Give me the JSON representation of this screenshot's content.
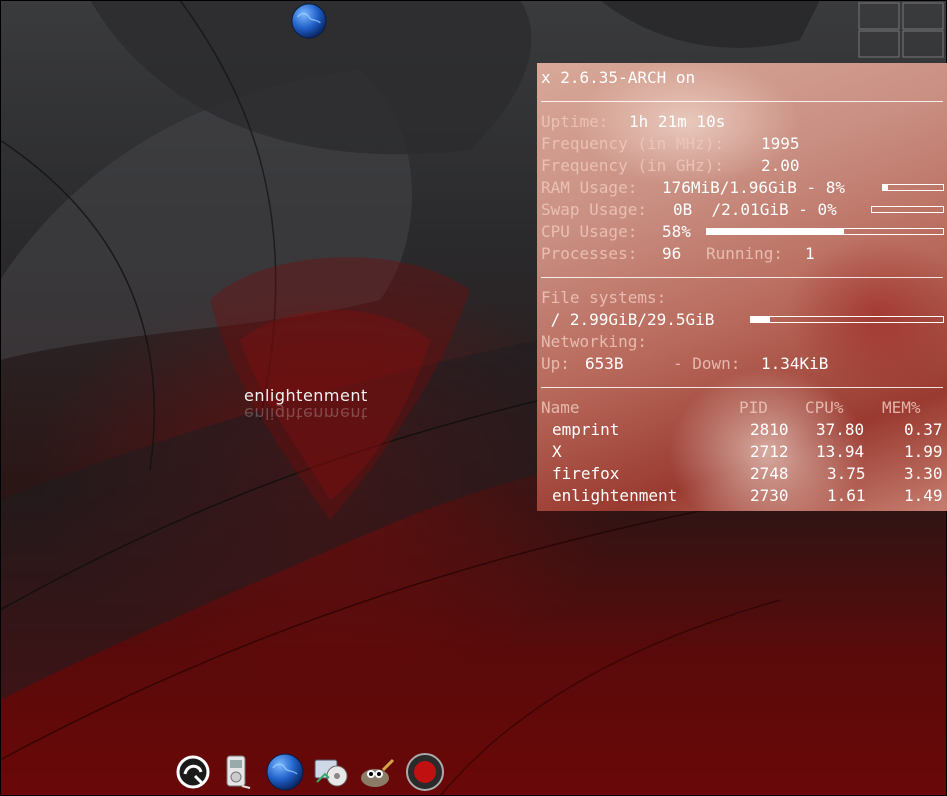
{
  "conky": {
    "title": "x 2.6.35-ARCH on",
    "uptime_label": "Uptime:",
    "uptime_value": "1h 21m 10s",
    "freq_mhz_label": "Frequency (in MHz):",
    "freq_mhz_value": "1995",
    "freq_ghz_label": "Frequency (in GHz):",
    "freq_ghz_value": "2.00",
    "ram_label": "RAM Usage:",
    "ram_value": "176MiB/1.96GiB - 8%",
    "ram_percent": 8,
    "swap_label": "Swap Usage:",
    "swap_value": "0B  /2.01GiB - 0%",
    "swap_percent": 0,
    "cpu_label": "CPU Usage:",
    "cpu_value": "58%",
    "cpu_percent": 58,
    "processes_label": "Processes:",
    "processes_value": "96",
    "running_label": "Running:",
    "running_value": "1",
    "fs_label": "File systems:",
    "fs_value": " / 2.99GiB/29.5GiB",
    "fs_percent": 10,
    "net_label": "Networking:",
    "up_label": "Up:",
    "up_value": "653B",
    "down_label": "- Down:",
    "down_value": "1.34KiB",
    "proc_headers": {
      "name": "Name",
      "pid": "PID",
      "cpu": "CPU%",
      "mem": "MEM%"
    },
    "processes": [
      {
        "name": "emprint",
        "pid": "2810",
        "cpu": "37.80",
        "mem": "0.37"
      },
      {
        "name": "X",
        "pid": "2712",
        "cpu": "13.94",
        "mem": "1.99"
      },
      {
        "name": "firefox",
        "pid": "2748",
        "cpu": "3.75",
        "mem": "3.30"
      },
      {
        "name": "enlightenment",
        "pid": "2730",
        "cpu": "1.61",
        "mem": "1.49"
      }
    ]
  },
  "desktop": {
    "logo_text": "enlightenment"
  },
  "dock": {
    "items": [
      {
        "icon": "enlightenment-menu-icon"
      },
      {
        "icon": "media-player-icon"
      },
      {
        "icon": "firefox-globe-icon"
      },
      {
        "icon": "multimedia-icon"
      },
      {
        "icon": "gimp-icon"
      },
      {
        "icon": "record-icon"
      }
    ]
  },
  "colors": {
    "accent": "#8b0a0a",
    "conky_text": "#ffffff"
  }
}
